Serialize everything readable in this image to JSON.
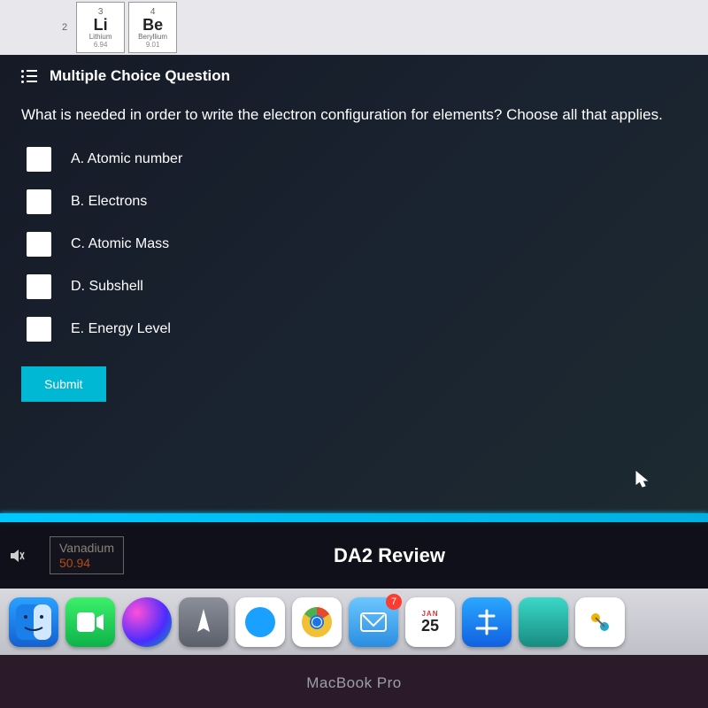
{
  "periodic": {
    "period_label": "2",
    "cell1": {
      "num": "3",
      "sym": "Li",
      "name": "Lithium",
      "mass": "6.94"
    },
    "cell2": {
      "num": "4",
      "sym": "Be",
      "name": "Beryllium",
      "mass": "9.01"
    }
  },
  "panel": {
    "header": "Multiple Choice Question",
    "question": "What is needed in order to write the electron configuration for elements? Choose all that applies.",
    "options": [
      "A.  Atomic number",
      "B.  Electrons",
      "C.  Atomic Mass",
      "D.  Subshell",
      "E.  Energy Level"
    ],
    "submit": "Submit"
  },
  "review": {
    "element_name": "Vanadium",
    "element_mass": "50.94",
    "title": "DA2 Review"
  },
  "dock": {
    "calendar_month": "JAN",
    "calendar_day": "25",
    "mail_badge": "7"
  },
  "device": {
    "label": "MacBook Pro"
  }
}
